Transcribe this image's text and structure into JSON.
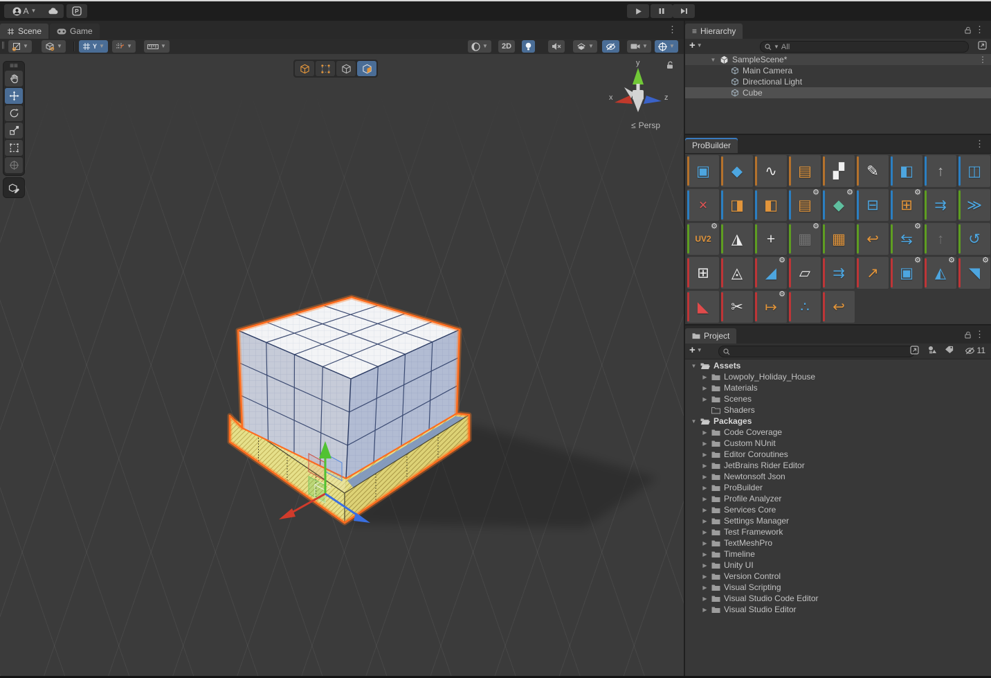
{
  "topbar": {
    "account_initial": "A",
    "playback": {
      "play": "play",
      "pause": "pause",
      "step": "step"
    }
  },
  "scene": {
    "tabs": [
      {
        "label": "Scene"
      },
      {
        "label": "Game"
      }
    ],
    "toolbar": {
      "grid_axis_label": "Y",
      "mode_2d_label": "2D"
    },
    "edit_modes": [
      {
        "name": "object-mode"
      },
      {
        "name": "vertex-mode"
      },
      {
        "name": "edge-mode"
      },
      {
        "name": "face-mode",
        "active": true
      }
    ],
    "gizmo": {
      "x_label": "x",
      "y_label": "y",
      "z_label": "z",
      "projection_label": "Persp"
    }
  },
  "hierarchy": {
    "title": "Hierarchy",
    "search_text": "All",
    "items": [
      {
        "label": "SampleScene*",
        "depth": 0,
        "icon": "scene",
        "expanded": true,
        "state": "focusrow",
        "kebab": true
      },
      {
        "label": "Main Camera",
        "depth": 1,
        "icon": "gameobject"
      },
      {
        "label": "Directional Light",
        "depth": 1,
        "icon": "gameobject"
      },
      {
        "label": "Cube",
        "depth": 1,
        "icon": "gameobject",
        "state": "selected"
      }
    ]
  },
  "probuilder": {
    "title": "ProBuilder",
    "icons": [
      {
        "name": "new-shape",
        "cat": "o",
        "g": "▣",
        "c": "#4da6e0"
      },
      {
        "name": "new-poly-shape",
        "cat": "o",
        "g": "◆",
        "c": "#4da6e0"
      },
      {
        "name": "new-bezier-shape",
        "cat": "o",
        "g": "∿",
        "c": "#e8e8e8"
      },
      {
        "name": "material-editor",
        "cat": "o",
        "g": "▤",
        "c": "#e2953b"
      },
      {
        "name": "uv-editor",
        "cat": "o",
        "g": "▞",
        "c": "#f0f0f0"
      },
      {
        "name": "vertex-colors",
        "cat": "o",
        "g": "✎",
        "c": "#efefef"
      },
      {
        "name": "smooth-group-editor",
        "cat": "b",
        "g": "◧",
        "c": "#4da6e0"
      },
      {
        "name": "probuilderize",
        "cat": "b",
        "g": "↑",
        "c": "#b8b8b8"
      },
      {
        "name": "export-asset",
        "cat": "b",
        "g": "◫",
        "c": "#4da6e0"
      },
      {
        "name": "select-hidden",
        "cat": "b",
        "g": "×",
        "c": "#e05555"
      },
      {
        "name": "handle-position",
        "cat": "b",
        "g": "◨",
        "c": "#e2953b"
      },
      {
        "name": "handle-rotation",
        "cat": "b",
        "g": "◧",
        "c": "#e2953b"
      },
      {
        "name": "select-by-material",
        "cat": "b",
        "g": "▤",
        "c": "#e2953b",
        "gear": true
      },
      {
        "name": "select-by-vertex-color",
        "cat": "b",
        "g": "◆",
        "c": "#5fbf9f",
        "gear": true
      },
      {
        "name": "shrink-selection",
        "cat": "b",
        "g": "⊟",
        "c": "#4da6e0"
      },
      {
        "name": "grow-selection",
        "cat": "b",
        "g": "⊞",
        "c": "#e2953b",
        "gear": true
      },
      {
        "name": "select-ring",
        "cat": "g",
        "g": "⇉",
        "c": "#4da6e0"
      },
      {
        "name": "select-loop",
        "cat": "g",
        "g": "≫",
        "c": "#4da6e0"
      },
      {
        "name": "lightmap-uvs",
        "cat": "g",
        "g": "UV2",
        "c": "#e2953b",
        "gear": true
      },
      {
        "name": "triangulate-object",
        "cat": "g",
        "g": "◮",
        "c": "#ececec"
      },
      {
        "name": "center-pivot",
        "cat": "g",
        "g": "+",
        "c": "#ececec"
      },
      {
        "name": "mirror-objects",
        "cat": "g",
        "g": "▦",
        "c": "#9a9a9a",
        "gear": true,
        "dim": true
      },
      {
        "name": "subdivide-object",
        "cat": "g",
        "g": "▦",
        "c": "#e2953b"
      },
      {
        "name": "flip-normals",
        "cat": "g",
        "g": "↩",
        "c": "#e2953b"
      },
      {
        "name": "conform-normals",
        "cat": "g",
        "g": "⇆",
        "c": "#4da6e0",
        "gear": true
      },
      {
        "name": "merge-objects",
        "cat": "g",
        "g": "↑",
        "c": "#9a9a9a",
        "dim": true
      },
      {
        "name": "freeze-transform",
        "cat": "g",
        "g": "↺",
        "c": "#4da6e0"
      },
      {
        "name": "subdivide-faces",
        "cat": "r",
        "g": "⊞",
        "c": "#ececec"
      },
      {
        "name": "triangulate-faces",
        "cat": "r",
        "g": "◬",
        "c": "#ececec"
      },
      {
        "name": "bevel-edges",
        "cat": "r",
        "g": "◢",
        "c": "#4da6e0",
        "gear": true
      },
      {
        "name": "fill-hole",
        "cat": "r",
        "g": "▱",
        "c": "#ececec"
      },
      {
        "name": "extrude-faces",
        "cat": "r",
        "g": "⇉",
        "c": "#4da6e0"
      },
      {
        "name": "flip-face-normals",
        "cat": "r",
        "g": "↗",
        "c": "#e2953b"
      },
      {
        "name": "duplicate-faces",
        "cat": "r",
        "g": "▣",
        "c": "#4da6e0",
        "gear": true
      },
      {
        "name": "merge-faces",
        "cat": "r",
        "g": "◭",
        "c": "#4da6e0",
        "gear": true
      },
      {
        "name": "detach-faces",
        "cat": "r",
        "g": "◥",
        "c": "#4da6e0",
        "gear": true
      },
      {
        "name": "delete-faces",
        "cat": "r",
        "g": "◣",
        "c": "#e04b4b"
      },
      {
        "name": "cut-tool",
        "cat": "r",
        "g": "✂",
        "c": "#ececec"
      },
      {
        "name": "offset-elements",
        "cat": "r",
        "g": "↦",
        "c": "#e2953b",
        "gear": true
      },
      {
        "name": "smart-connect",
        "cat": "r",
        "g": "∴",
        "c": "#4da6e0"
      },
      {
        "name": "flip-face-edge",
        "cat": "r",
        "g": "↩",
        "c": "#e2953b"
      }
    ]
  },
  "project": {
    "title": "Project",
    "hidden_count": "11",
    "items": [
      {
        "label": "Assets",
        "depth": 0,
        "bold": true,
        "expanded": true,
        "icon": "folder-open"
      },
      {
        "label": "Lowpoly_Holiday_House",
        "depth": 1,
        "arrow": true,
        "icon": "folder"
      },
      {
        "label": "Materials",
        "depth": 1,
        "arrow": true,
        "icon": "folder"
      },
      {
        "label": "Scenes",
        "depth": 1,
        "arrow": true,
        "icon": "folder"
      },
      {
        "label": "Shaders",
        "depth": 1,
        "icon": "folder-empty"
      },
      {
        "label": "Packages",
        "depth": 0,
        "bold": true,
        "expanded": true,
        "icon": "folder-open"
      },
      {
        "label": "Code Coverage",
        "depth": 1,
        "arrow": true,
        "icon": "folder"
      },
      {
        "label": "Custom NUnit",
        "depth": 1,
        "arrow": true,
        "icon": "folder"
      },
      {
        "label": "Editor Coroutines",
        "depth": 1,
        "arrow": true,
        "icon": "folder"
      },
      {
        "label": "JetBrains Rider Editor",
        "depth": 1,
        "arrow": true,
        "icon": "folder"
      },
      {
        "label": "Newtonsoft Json",
        "depth": 1,
        "arrow": true,
        "icon": "folder"
      },
      {
        "label": "ProBuilder",
        "depth": 1,
        "arrow": true,
        "icon": "folder"
      },
      {
        "label": "Profile Analyzer",
        "depth": 1,
        "arrow": true,
        "icon": "folder"
      },
      {
        "label": "Services Core",
        "depth": 1,
        "arrow": true,
        "icon": "folder"
      },
      {
        "label": "Settings Manager",
        "depth": 1,
        "arrow": true,
        "icon": "folder"
      },
      {
        "label": "Test Framework",
        "depth": 1,
        "arrow": true,
        "icon": "folder"
      },
      {
        "label": "TextMeshPro",
        "depth": 1,
        "arrow": true,
        "icon": "folder"
      },
      {
        "label": "Timeline",
        "depth": 1,
        "arrow": true,
        "icon": "folder"
      },
      {
        "label": "Unity UI",
        "depth": 1,
        "arrow": true,
        "icon": "folder"
      },
      {
        "label": "Version Control",
        "depth": 1,
        "arrow": true,
        "icon": "folder"
      },
      {
        "label": "Visual Scripting",
        "depth": 1,
        "arrow": true,
        "icon": "folder"
      },
      {
        "label": "Visual Studio Code Editor",
        "depth": 1,
        "arrow": true,
        "icon": "folder"
      },
      {
        "label": "Visual Studio Editor",
        "depth": 1,
        "arrow": true,
        "icon": "folder"
      }
    ]
  },
  "colors": {
    "accent_blue": "#4a6d96",
    "stripe_orange": "#b5722c",
    "stripe_blue": "#2b7fc2",
    "stripe_green": "#5e9e21",
    "stripe_red": "#be3537",
    "selection_outline": "#ff6d1f"
  }
}
